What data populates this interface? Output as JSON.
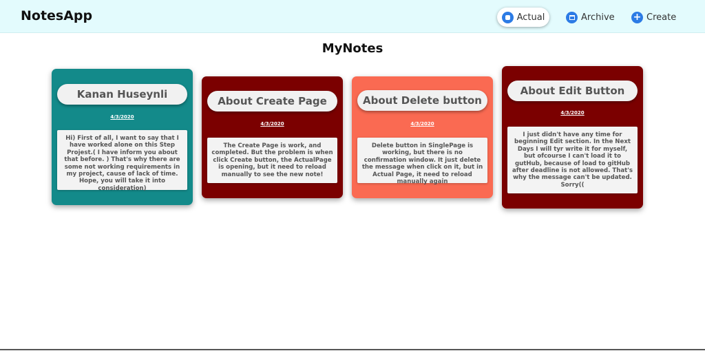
{
  "header": {
    "brand": "NotesApp",
    "nav": [
      {
        "label": "Actual",
        "icon": "note-icon"
      },
      {
        "label": "Archive",
        "icon": "archive-icon"
      },
      {
        "label": "Create",
        "icon": "plus-icon"
      }
    ]
  },
  "main": {
    "title": "MyNotes",
    "notes": [
      {
        "title": "Kanan Huseynli",
        "date": "4/3/2020",
        "body": "Hi) First of all, I want to say that I have worked alone on this Step Projest.( I have inform you about that before. ) That's why there are some not working requirements in my project, cause of lack of time. Hope, you will take it into consideration)",
        "color": "#138a8a"
      },
      {
        "title": "About Create Page",
        "date": "4/3/2020",
        "body": "The Create Page is work, and completed. But the problem is when click Create button, the ActualPage is opening, but it need to reload manually to see the new note!",
        "color": "#7b0000"
      },
      {
        "title": "About Delete button",
        "date": "4/3/2020",
        "body": "Delete button in SinglePage is working, but there is no confirmation window. It just delete the message when click on it, but in Actual Page, it need to reload manually again",
        "color": "#fa6a52"
      },
      {
        "title": "About Edit Button",
        "date": "4/3/2020",
        "body": "I just didn't have any time for beginning Edit section. In the Next Days I will tyr write it for myself, but ofcourse I can't load it to gutHub, because of load to gitHub after deadline is not allowed. That's why the message can't be updated. Sorry((",
        "color": "#7b0000"
      }
    ]
  }
}
